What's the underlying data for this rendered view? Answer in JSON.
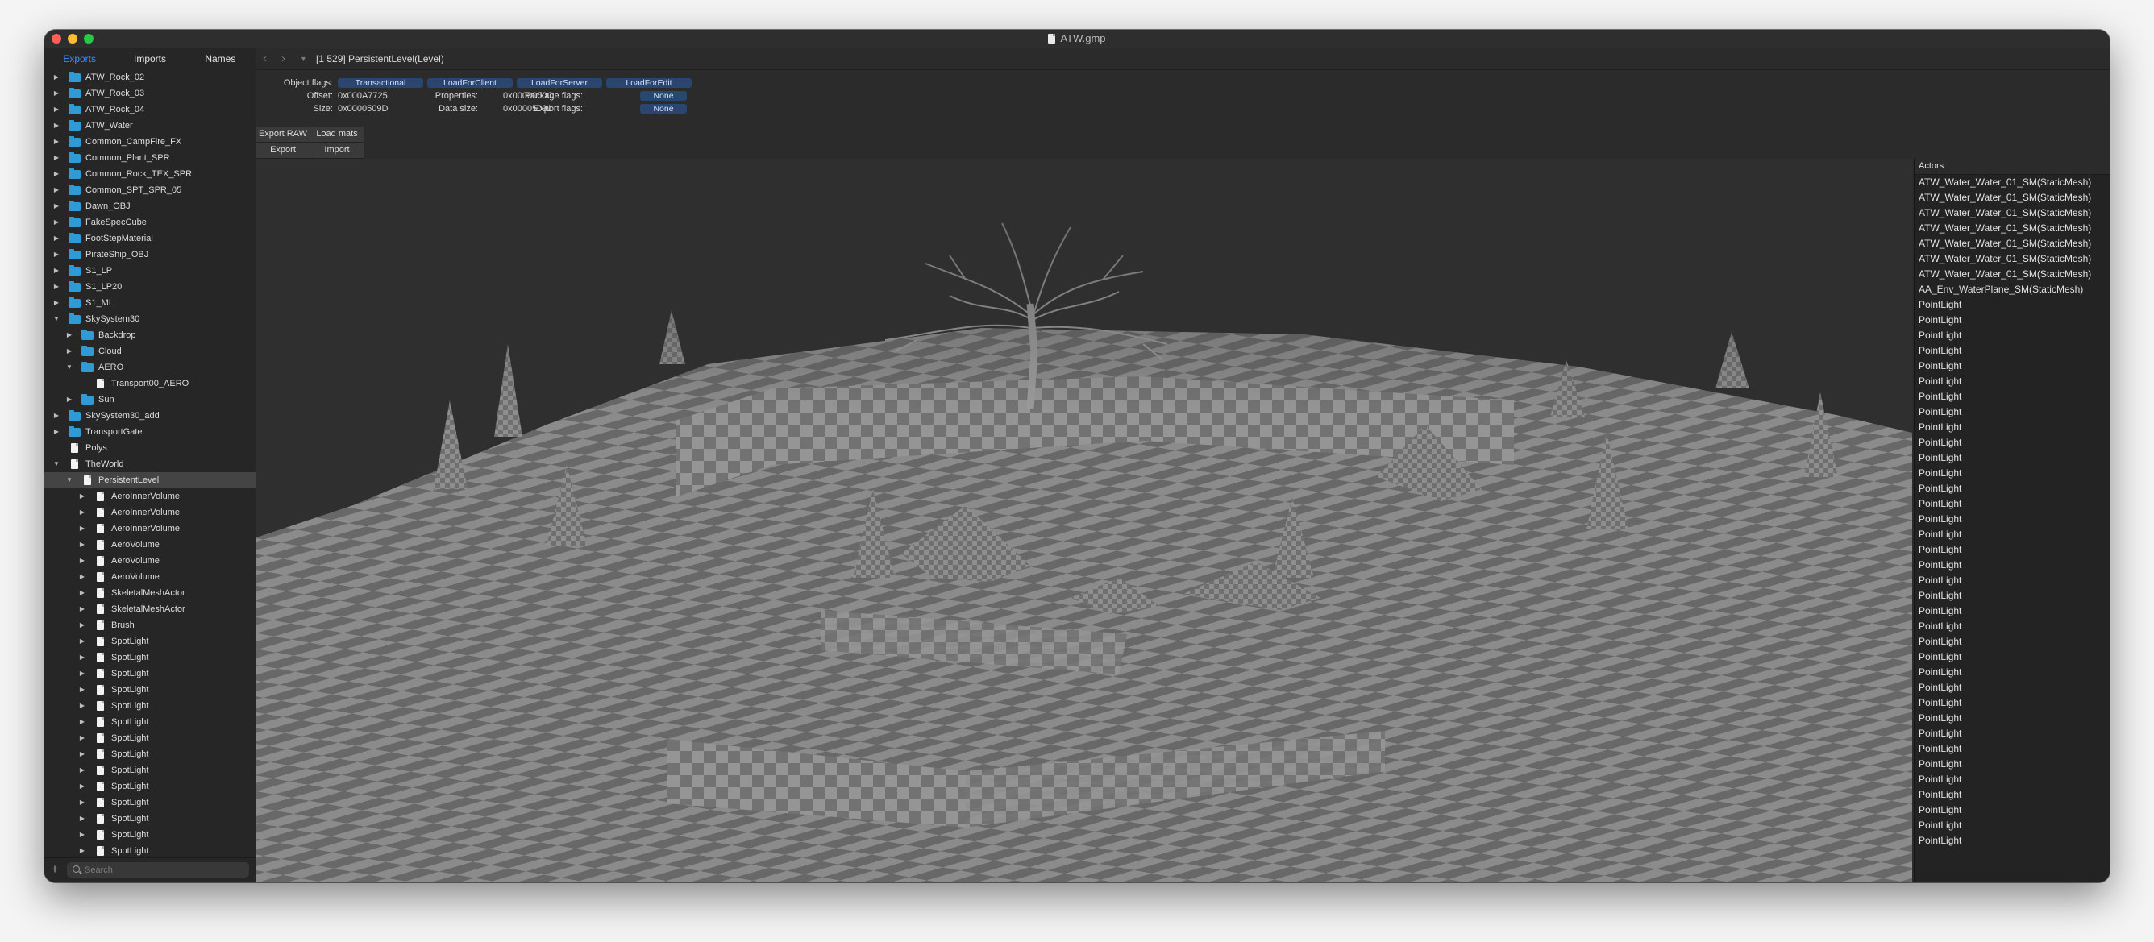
{
  "window": {
    "title": "ATW.gmp"
  },
  "sidebar": {
    "tabs": [
      "Exports",
      "Imports",
      "Names"
    ],
    "active_tab": "Exports",
    "search_placeholder": "Search",
    "items": [
      {
        "label": "ATW_Rock_02",
        "depth": 0,
        "arrow": "collapsed",
        "icon": "folder"
      },
      {
        "label": "ATW_Rock_03",
        "depth": 0,
        "arrow": "collapsed",
        "icon": "folder"
      },
      {
        "label": "ATW_Rock_04",
        "depth": 0,
        "arrow": "collapsed",
        "icon": "folder"
      },
      {
        "label": "ATW_Water",
        "depth": 0,
        "arrow": "collapsed",
        "icon": "folder"
      },
      {
        "label": "Common_CampFire_FX",
        "depth": 0,
        "arrow": "collapsed",
        "icon": "folder"
      },
      {
        "label": "Common_Plant_SPR",
        "depth": 0,
        "arrow": "collapsed",
        "icon": "folder"
      },
      {
        "label": "Common_Rock_TEX_SPR",
        "depth": 0,
        "arrow": "collapsed",
        "icon": "folder"
      },
      {
        "label": "Common_SPT_SPR_05",
        "depth": 0,
        "arrow": "collapsed",
        "icon": "folder"
      },
      {
        "label": "Dawn_OBJ",
        "depth": 0,
        "arrow": "collapsed",
        "icon": "folder"
      },
      {
        "label": "FakeSpecCube",
        "depth": 0,
        "arrow": "collapsed",
        "icon": "folder"
      },
      {
        "label": "FootStepMaterial",
        "depth": 0,
        "arrow": "collapsed",
        "icon": "folder"
      },
      {
        "label": "PirateShip_OBJ",
        "depth": 0,
        "arrow": "collapsed",
        "icon": "folder"
      },
      {
        "label": "S1_LP",
        "depth": 0,
        "arrow": "collapsed",
        "icon": "folder"
      },
      {
        "label": "S1_LP20",
        "depth": 0,
        "arrow": "collapsed",
        "icon": "folder"
      },
      {
        "label": "S1_MI",
        "depth": 0,
        "arrow": "collapsed",
        "icon": "folder"
      },
      {
        "label": "SkySystem30",
        "depth": 0,
        "arrow": "expanded",
        "icon": "folder"
      },
      {
        "label": "Backdrop",
        "depth": 1,
        "arrow": "collapsed",
        "icon": "folder"
      },
      {
        "label": "Cloud",
        "depth": 1,
        "arrow": "collapsed",
        "icon": "folder"
      },
      {
        "label": "AERO",
        "depth": 1,
        "arrow": "expanded",
        "icon": "folder"
      },
      {
        "label": "Transport00_AERO",
        "depth": 2,
        "arrow": "none",
        "icon": "file"
      },
      {
        "label": "Sun",
        "depth": 1,
        "arrow": "collapsed",
        "icon": "folder"
      },
      {
        "label": "SkySystem30_add",
        "depth": 0,
        "arrow": "collapsed",
        "icon": "folder"
      },
      {
        "label": "TransportGate",
        "depth": 0,
        "arrow": "collapsed",
        "icon": "folder"
      },
      {
        "label": "Polys",
        "depth": 0,
        "arrow": "none",
        "icon": "file"
      },
      {
        "label": "TheWorld",
        "depth": 0,
        "arrow": "expanded",
        "icon": "file"
      },
      {
        "label": "PersistentLevel",
        "depth": 1,
        "arrow": "expanded",
        "icon": "file",
        "selected": true
      },
      {
        "label": "AeroInnerVolume",
        "depth": 2,
        "arrow": "collapsed",
        "icon": "file"
      },
      {
        "label": "AeroInnerVolume",
        "depth": 2,
        "arrow": "collapsed",
        "icon": "file"
      },
      {
        "label": "AeroInnerVolume",
        "depth": 2,
        "arrow": "collapsed",
        "icon": "file"
      },
      {
        "label": "AeroVolume",
        "depth": 2,
        "arrow": "collapsed",
        "icon": "file"
      },
      {
        "label": "AeroVolume",
        "depth": 2,
        "arrow": "collapsed",
        "icon": "file"
      },
      {
        "label": "AeroVolume",
        "depth": 2,
        "arrow": "collapsed",
        "icon": "file"
      },
      {
        "label": "SkeletalMeshActor",
        "depth": 2,
        "arrow": "collapsed",
        "icon": "file"
      },
      {
        "label": "SkeletalMeshActor",
        "depth": 2,
        "arrow": "collapsed",
        "icon": "file"
      },
      {
        "label": "Brush",
        "depth": 2,
        "arrow": "collapsed",
        "icon": "file"
      },
      {
        "label": "SpotLight",
        "depth": 2,
        "arrow": "collapsed",
        "icon": "file"
      },
      {
        "label": "SpotLight",
        "depth": 2,
        "arrow": "collapsed",
        "icon": "file"
      },
      {
        "label": "SpotLight",
        "depth": 2,
        "arrow": "collapsed",
        "icon": "file"
      },
      {
        "label": "SpotLight",
        "depth": 2,
        "arrow": "collapsed",
        "icon": "file"
      },
      {
        "label": "SpotLight",
        "depth": 2,
        "arrow": "collapsed",
        "icon": "file"
      },
      {
        "label": "SpotLight",
        "depth": 2,
        "arrow": "collapsed",
        "icon": "file"
      },
      {
        "label": "SpotLight",
        "depth": 2,
        "arrow": "collapsed",
        "icon": "file"
      },
      {
        "label": "SpotLight",
        "depth": 2,
        "arrow": "collapsed",
        "icon": "file"
      },
      {
        "label": "SpotLight",
        "depth": 2,
        "arrow": "collapsed",
        "icon": "file"
      },
      {
        "label": "SpotLight",
        "depth": 2,
        "arrow": "collapsed",
        "icon": "file"
      },
      {
        "label": "SpotLight",
        "depth": 2,
        "arrow": "collapsed",
        "icon": "file"
      },
      {
        "label": "SpotLight",
        "depth": 2,
        "arrow": "collapsed",
        "icon": "file"
      },
      {
        "label": "SpotLight",
        "depth": 2,
        "arrow": "collapsed",
        "icon": "file"
      },
      {
        "label": "SpotLight",
        "depth": 2,
        "arrow": "collapsed",
        "icon": "file"
      }
    ]
  },
  "nav": {
    "back_icon": "chevron-left-icon",
    "forward_icon": "chevron-right-icon",
    "menu_icon": "triangle-down-icon",
    "breadcrumb": "[1 529]  PersistentLevel(Level)"
  },
  "info": {
    "object_flags_label": "Object flags:",
    "object_flags": [
      "Transactional",
      "LoadForClient",
      "LoadForServer",
      "LoadForEdit"
    ],
    "offset_label": "Offset:",
    "offset_value": "0x000A7725",
    "properties_label": "Properties:",
    "properties_value": "0x0000000C",
    "package_flags_label": "Package flags:",
    "package_flags_value": "None",
    "size_label": "Size:",
    "size_value": "0x0000509D",
    "data_size_label": "Data size:",
    "data_size_value": "0x00005091",
    "export_flags_label": "Export flags:",
    "export_flags_value": "None",
    "flag_color": "#28466e"
  },
  "toolbar": {
    "export_raw": "Export RAW",
    "load_mats": "Load mats",
    "export": "Export",
    "import": "Import"
  },
  "actors": {
    "title": "Actors",
    "items": [
      "ATW_Water_Water_01_SM(StaticMesh)",
      "ATW_Water_Water_01_SM(StaticMesh)",
      "ATW_Water_Water_01_SM(StaticMesh)",
      "ATW_Water_Water_01_SM(StaticMesh)",
      "ATW_Water_Water_01_SM(StaticMesh)",
      "ATW_Water_Water_01_SM(StaticMesh)",
      "ATW_Water_Water_01_SM(StaticMesh)",
      "AA_Env_WaterPlane_SM(StaticMesh)",
      "PointLight",
      "PointLight",
      "PointLight",
      "PointLight",
      "PointLight",
      "PointLight",
      "PointLight",
      "PointLight",
      "PointLight",
      "PointLight",
      "PointLight",
      "PointLight",
      "PointLight",
      "PointLight",
      "PointLight",
      "PointLight",
      "PointLight",
      "PointLight",
      "PointLight",
      "PointLight",
      "PointLight",
      "PointLight",
      "PointLight",
      "PointLight",
      "PointLight",
      "PointLight",
      "PointLight",
      "PointLight",
      "PointLight",
      "PointLight",
      "PointLight",
      "PointLight",
      "PointLight",
      "PointLight",
      "PointLight",
      "PointLight"
    ]
  },
  "colors": {
    "accent": "#3d8ef7",
    "folder": "#2e9bd6",
    "window_bg": "#2b2b2b",
    "checker_light": "#8d8d8d",
    "checker_dark": "#6a6a6a"
  }
}
